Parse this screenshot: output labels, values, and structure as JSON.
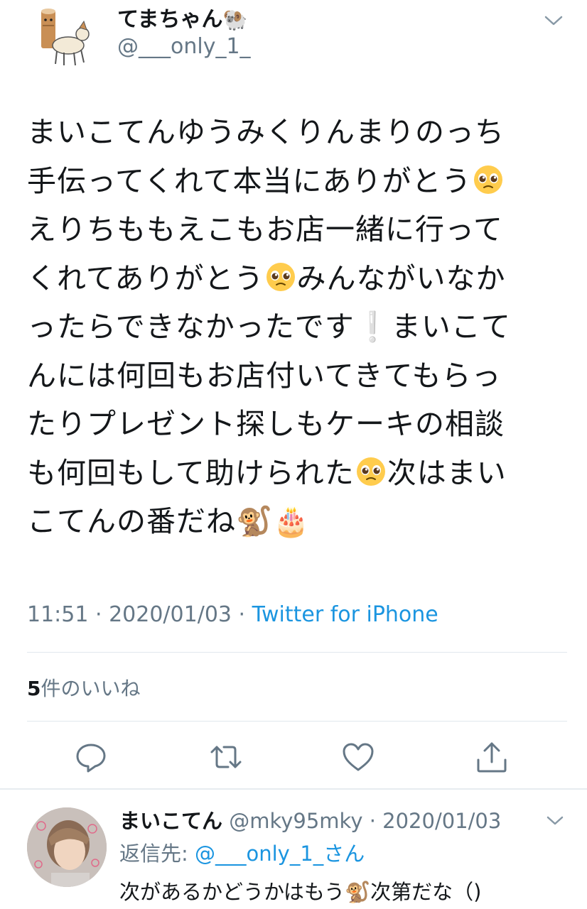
{
  "tweet": {
    "author": {
      "name": "てまちゃん",
      "name_emoji": "🐏",
      "handle": "@___only_1_"
    },
    "text_lines": [
      {
        "a": "まいこてんゆうみくりんまりのっち"
      },
      {
        "a": "手伝ってくれて本当にありがとう",
        "emoji": "pleading-face"
      },
      {
        "a": "えりちももえこもお店一緒に行って"
      },
      {
        "a": "くれてありがとう",
        "emoji": "pleading-face",
        "b": "みんながいなか"
      },
      {
        "a": "ったらできなかったです",
        "b": "まいこて"
      },
      {
        "a": "んには何回もお店付いてきてもらっ"
      },
      {
        "a": "たりプレゼント探しもケーキの相談"
      },
      {
        "a": "も何回もして助けられた",
        "emoji": "pleading-face",
        "b": "次はまい"
      },
      {
        "a": "こてんの番だね"
      }
    ],
    "exclamation": "❕",
    "monkey_emoji": "🐒",
    "cake_emoji": "🎂",
    "time": "11:51",
    "date": "2020/01/03",
    "separator": " · ",
    "source": "Twitter for iPhone",
    "likes_count": "5",
    "likes_label": "件のいいね"
  },
  "actions": [
    {
      "name": "reply-icon"
    },
    {
      "name": "retweet-icon"
    },
    {
      "name": "like-icon"
    },
    {
      "name": "share-icon"
    }
  ],
  "reply": {
    "name": "まいこてん",
    "handle": "@mky95mky",
    "date": "2020/01/03",
    "reply_to_label": "返信先: ",
    "reply_to_handle": "@___only_1_さん",
    "text_a": "次があるかどうかはもう",
    "text_b": "次第だな（)"
  },
  "colors": {
    "accent": "#1b95e0",
    "secondary_text": "#657786",
    "primary_text": "#14171a",
    "divider": "#e1e8ed"
  }
}
